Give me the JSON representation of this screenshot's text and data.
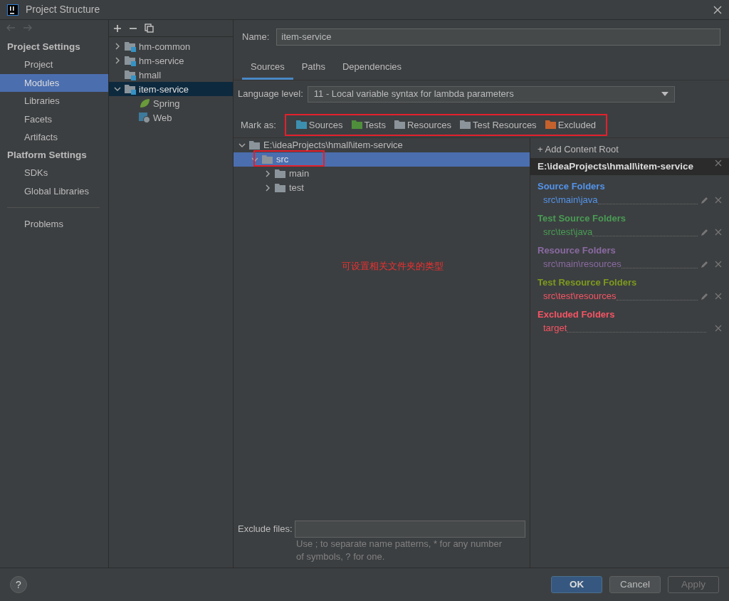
{
  "window": {
    "title": "Project Structure"
  },
  "sidebar": {
    "sections": [
      {
        "title": "Project Settings",
        "items": [
          {
            "label": "Project",
            "selected": false
          },
          {
            "label": "Modules",
            "selected": true
          },
          {
            "label": "Libraries",
            "selected": false
          },
          {
            "label": "Facets",
            "selected": false
          },
          {
            "label": "Artifacts",
            "selected": false
          }
        ]
      },
      {
        "title": "Platform Settings",
        "items": [
          {
            "label": "SDKs",
            "selected": false
          },
          {
            "label": "Global Libraries",
            "selected": false
          }
        ]
      },
      {
        "items": [
          {
            "label": "Problems",
            "selected": false
          }
        ]
      }
    ]
  },
  "modules": [
    {
      "label": "hm-common",
      "kind": "module",
      "expanded": false,
      "selected": false
    },
    {
      "label": "hm-service",
      "kind": "module",
      "expanded": false,
      "selected": false
    },
    {
      "label": "hmall",
      "kind": "module",
      "selected": false
    },
    {
      "label": "item-service",
      "kind": "module",
      "expanded": true,
      "selected": true,
      "children": [
        {
          "label": "Spring",
          "kind": "spring",
          "selected": false
        },
        {
          "label": "Web",
          "kind": "web",
          "selected": false
        }
      ]
    }
  ],
  "name_field": {
    "label": "Name:",
    "value": "item-service"
  },
  "tabs": [
    {
      "label": "Sources",
      "selected": true
    },
    {
      "label": "Paths",
      "selected": false
    },
    {
      "label": "Dependencies",
      "selected": false
    }
  ],
  "language_level": {
    "label": "Language level:",
    "value": "11 - Local variable syntax for lambda parameters"
  },
  "mark_as": {
    "label": "Mark as:",
    "buttons": [
      {
        "label": "Sources",
        "color": "#3d8fb0"
      },
      {
        "label": "Tests",
        "color": "#4f8f3c"
      },
      {
        "label": "Resources",
        "color": "#8b949b"
      },
      {
        "label": "Test Resources",
        "color": "#8b949b"
      },
      {
        "label": "Excluded",
        "color": "#c4612c"
      }
    ]
  },
  "content_tree": [
    {
      "label": "E:\\ideaProjects\\hmall\\item-service",
      "expanded": true,
      "selected": false,
      "children": [
        {
          "label": "src",
          "expanded": true,
          "selected": true,
          "children": [
            {
              "label": "main",
              "expanded": false,
              "selected": false
            },
            {
              "label": "test",
              "expanded": false,
              "selected": false
            }
          ]
        }
      ]
    }
  ],
  "annotation": "可设置相关文件夹的类型",
  "exclude_files": {
    "label": "Exclude files:",
    "hint": "Use ; to separate name patterns, * for any number of symbols, ? for one."
  },
  "content_root": {
    "add_label": "+ Add Content Root",
    "path": "E:\\ideaProjects\\hmall\\item-service",
    "sections": [
      {
        "title": "Source Folders",
        "color": "#5394ec",
        "entries": [
          {
            "path": "src\\main\\java",
            "color": "#5394ec",
            "editable": true
          }
        ]
      },
      {
        "title": "Test Source Folders",
        "color": "#499c54",
        "entries": [
          {
            "path": "src\\test\\java",
            "color": "#499c54",
            "editable": true
          }
        ]
      },
      {
        "title": "Resource Folders",
        "color": "#8a6aa3",
        "entries": [
          {
            "path": "src\\main\\resources",
            "color": "#8a6aa3",
            "editable": true
          }
        ]
      },
      {
        "title": "Test Resource Folders",
        "color": "#7d9a1d",
        "entries": [
          {
            "path": "src\\test\\resources",
            "color": "#f75464",
            "editable": true
          }
        ]
      },
      {
        "title": "Excluded Folders",
        "color": "#f75464",
        "entries": [
          {
            "path": "target",
            "color": "#f75464",
            "editable": false
          }
        ]
      }
    ]
  },
  "buttons": [
    {
      "label": "OK",
      "kind": "primary",
      "disabled": false
    },
    {
      "label": "Cancel",
      "kind": "normal",
      "disabled": false
    },
    {
      "label": "Apply",
      "kind": "normal",
      "disabled": true
    }
  ],
  "help_label": "?"
}
